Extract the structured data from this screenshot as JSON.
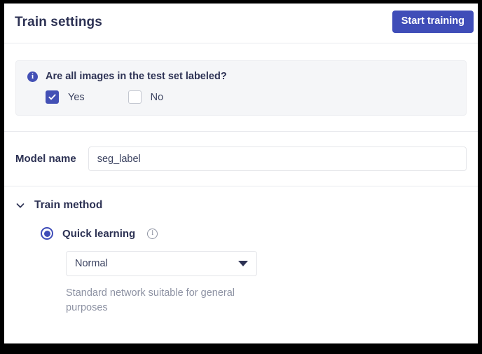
{
  "header": {
    "title": "Train settings",
    "start_button_label": "Start training"
  },
  "info_box": {
    "icon": "info-circle-filled-icon",
    "question": "Are all images in the test set labeled?",
    "options": [
      {
        "label": "Yes",
        "checked": true
      },
      {
        "label": "No",
        "checked": false
      }
    ]
  },
  "model_name": {
    "label": "Model name",
    "value": "seg_label",
    "placeholder": "Model name"
  },
  "train_method": {
    "title": "Train method",
    "collapse_icon": "chevron-down-icon",
    "expanded": true,
    "option": {
      "label": "Quick learning",
      "selected": true,
      "info_icon": "info-circle-outline-icon"
    },
    "network_select": {
      "value": "Normal",
      "caret_icon": "caret-down-icon"
    },
    "description": "Standard network suitable for general purposes"
  },
  "colors": {
    "accent": "#3f4db8",
    "accent_alt": "#4350b5",
    "title_text": "#2d3254",
    "body_text": "#3b4260",
    "muted_text": "#8d92a3",
    "panel_bg": "#ffffff",
    "infobox_bg": "#f5f6f8",
    "divider": "#e9eaee",
    "frame": "#000000"
  }
}
